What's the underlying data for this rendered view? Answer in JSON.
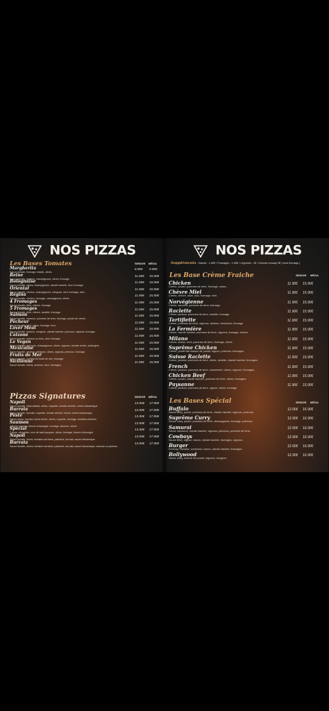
{
  "left": {
    "title": "NOS PIZZAS",
    "section1": "Les Bases Tomates",
    "col1": "SENIOR",
    "col2": "MÉGA",
    "items1": [
      {
        "name": "Margherita",
        "desc": "Sauce tomate, fromage, basilic, olives.",
        "p1": "8.90€",
        "p2": "9.90€"
      },
      {
        "name": "Reine",
        "desc": "Sauce tomate, jambon, champignons, olives, fromage.",
        "p1": "11.90€",
        "p2": "15.90€"
      },
      {
        "name": "Bolognaise",
        "desc": "Sauce tomate, olives, champignons, viande hachée, œuf, fromage.",
        "p1": "11.90€",
        "p2": "15.90€"
      },
      {
        "name": "Oriental",
        "desc": "Sauce tomate, chorizo, champignons, merguez, œuf, fromage, olive.",
        "p1": "11.90€",
        "p2": "15.90€"
      },
      {
        "name": "Regina",
        "desc": "Sauce tomate, chorizo, fromage, champignons, olives.",
        "p1": "11.90€",
        "p2": "15.90€"
      },
      {
        "name": "4 Fromages",
        "desc": "Sauce tomate, bleu, chèvre, fromage.",
        "p1": "11.90€",
        "p2": "15.90€"
      },
      {
        "name": "5 Fromages",
        "desc": "Sauce tomate, bleu, chèvre, raclette, fromage.",
        "p1": "11.90€",
        "p2": "15.90€"
      },
      {
        "name": "Salmon",
        "desc": "Sauce tomate, saumon, pommes de terre, fromage, pointe de crème.",
        "p1": "11.90€",
        "p2": "15.90€"
      },
      {
        "name": "Pêcheur",
        "desc": "Sauce tomate, seuf, olives, fromage, thon.",
        "p1": "11.90€",
        "p2": "15.90€"
      },
      {
        "name": "Lover Meat",
        "desc": "Sauce tomate, jambon, merguez, viande hachée, poivrons, oignons, fromage.",
        "p1": "11.90€",
        "p2": "15.90€"
      },
      {
        "name": "Calzone",
        "desc": "Sauce tomate, jambon ou thon, œuf, fromage.",
        "p1": "11.90€",
        "p2": "15.90€"
      },
      {
        "name": "Le Vegan",
        "desc": "Sauce tomate, poivrons, champignons, olives, oignons, tomate cerise, aubergine.",
        "p1": "11.90€",
        "p2": "15.90€"
      },
      {
        "name": "Mexicaine",
        "desc": "Sauce tomate, chorizo, merguez, olives, oignons, poivrons, fromage.",
        "p1": "11.90€",
        "p2": "15.90€"
      },
      {
        "name": "Fruits de Mer",
        "desc": "Sauce tomate, cocktail de fruits de mer, fromage.",
        "p1": "11.90€",
        "p2": "15.90€"
      },
      {
        "name": "Sicilienne",
        "desc": "Sauce tomate, olives, anchois, thon, fromages.",
        "p1": "11.90€",
        "p2": "15.90€"
      }
    ],
    "section2": "Pizzas Signatures",
    "items2": [
      {
        "name": "Napoli",
        "desc": "Sauce tomate, stracciatella, olives, roquette, tomate séchée, crème balsamique",
        "p1": "13.90€",
        "p2": "17.90€"
      },
      {
        "name": "Burrata",
        "desc": "Sauce tomate, burrata, roquette, tomate séchée, olives, crème balsamique",
        "p1": "13.90€",
        "p2": "17.90€"
      },
      {
        "name": "Peste",
        "desc": "Sauce pesto, burrata, bœuf séché, olives, roquette, fromage, tomates séchées",
        "p1": "13.90€",
        "p2": "17.90€"
      },
      {
        "name": "Saumon",
        "desc": "Crème, saumon, beurre d'escargot, fromage, saumon, olives",
        "p1": "13.90€",
        "p2": "17.90€"
      },
      {
        "name": "Spécial",
        "desc": "Crème, ciboulette, noix de saint jacques, olives, fromage, beurre d'escargot",
        "p1": "13.90€",
        "p2": "17.90€"
      },
      {
        "name": "Napoli",
        "desc": "Sauce tomate, olives, tomates séchées, pastrami, burrata, sauce balsamique",
        "p1": "13.90€",
        "p2": "17.90€"
      },
      {
        "name": "Burrata",
        "desc": "Sauce tomate, olives, tomates séchées, pastrami, burrata, sauce balsamique, saumon ou jambon",
        "p1": "13.90€",
        "p2": "17.90€"
      }
    ]
  },
  "right": {
    "title": "NOS PIZZAS",
    "supp_label": "Suppléments",
    "supp_text": ": Viande : 1,50€ / Fromages : 1,50€ / Légumes : 1€ / Cheese crousty 2€ ( bord fromage )",
    "section1": "Les Base Crème Fraiche",
    "col1": "SENIOR",
    "col2": "MÉGA",
    "items1": [
      {
        "name": "Chicken",
        "desc": "Crème, poulet, pommes de terre, fromage, olives.",
        "p1": "11.90€",
        "p2": "15.90€"
      },
      {
        "name": "Chèvre Miel",
        "desc": "Crème, chèvre, olive, noix, fromage, miel.",
        "p1": "11.90€",
        "p2": "15.90€"
      },
      {
        "name": "Norvégienne",
        "desc": "Crème, saumon, pommes de terre, fromage.",
        "p1": "11.90€",
        "p2": "15.90€"
      },
      {
        "name": "Raclette",
        "desc": "Crème, jambon, pommes de terre, raclette, fromage.",
        "p1": "11.90€",
        "p2": "15.90€"
      },
      {
        "name": "Tartiflette",
        "desc": "Crème, pommes de terre, oignons, lardons, reblochon, fromage.",
        "p1": "11.90€",
        "p2": "15.90€"
      },
      {
        "name": "La Fermière",
        "desc": "Crème, viande hachée, pommes de terre, oignons, fromage, chèvre.",
        "p1": "11.90€",
        "p2": "15.90€"
      },
      {
        "name": "Milano",
        "desc": "Crème, lardon, œuf, pommes de terre, fromage, olives.",
        "p1": "11.90€",
        "p2": "15.90€"
      },
      {
        "name": "Suprême Chicken",
        "desc": "Crème, poulet fait maison de poulet, oignon, poivrons, fromages.",
        "p1": "11.90€",
        "p2": "15.90€"
      },
      {
        "name": "Suisse Raclette",
        "desc": "Crème, jambon, pommes de terre, olives, raclette, viande hachée, fromages.",
        "p1": "11.90€",
        "p2": "15.90€"
      },
      {
        "name": "French",
        "desc": "Crème, jambon, pommes de terre, camembert, olives, oignons, fromages.",
        "p1": "11.90€",
        "p2": "15.90€"
      },
      {
        "name": "Chicken Beef",
        "desc": "Crème, poulet, viande hachée, pommes de terre, olives, fromages.",
        "p1": "11.90€",
        "p2": "15.90€"
      },
      {
        "name": "Paysanne",
        "desc": "Crème, jambon, pommes de terre, oignon, olives, fromage.",
        "p1": "11.90€",
        "p2": "15.90€"
      }
    ],
    "section2": "Les Bases Spécial",
    "items2": [
      {
        "name": "Buffalo",
        "desc": "Sauce BBQ, poulet, pommes de terre, viande hachée, oignons, poivrons.",
        "p1": "12.90€",
        "p2": "16.90€"
      },
      {
        "name": "Suprême Curry",
        "desc": "Sauce curry, poulet, pommes de terre, champignons, fromage, poivrons.",
        "p1": "12.90€",
        "p2": "16.90€"
      },
      {
        "name": "Samurai",
        "desc": "Sauce samouraï, viande hachée, oignons, poivrons, pommes de terre.",
        "p1": "12.90€",
        "p2": "16.90€"
      },
      {
        "name": "Cowboys",
        "desc": "Sauce BBQ, oignon, bacon, viande hachée, fromages, oignons.",
        "p1": "12.90€",
        "p2": "16.90€"
      },
      {
        "name": "Burger",
        "desc": "Ketchup, cheddar, cornichon, bacon, viande hachée, fromages.",
        "p1": "12.90€",
        "p2": "16.90€"
      },
      {
        "name": "Bollywood",
        "desc": "Sauce curry, émincé de poulet, oignons, merguez.",
        "p1": "12.90€",
        "p2": "16.90€"
      }
    ]
  }
}
